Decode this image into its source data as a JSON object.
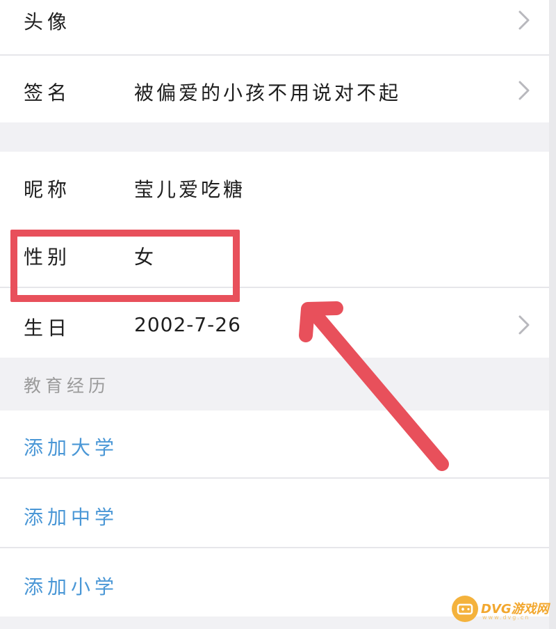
{
  "profile": {
    "avatar_label": "头像",
    "signature_label": "签名",
    "signature_value": "被偏爱的小孩不用说对不起",
    "nickname_label": "昵称",
    "nickname_value": "莹儿爱吃糖",
    "gender_label": "性别",
    "gender_value": "女",
    "birthday_label": "生日",
    "birthday_value": "2002-7-26"
  },
  "education": {
    "title": "教育经历",
    "add_university": "添加大学",
    "add_middle_school": "添加中学",
    "add_primary_school": "添加小学"
  },
  "watermark": {
    "text": "DVG游戏网",
    "sub": "www.dvg.cn"
  },
  "colors": {
    "accent_link": "#4a97d6",
    "annotation_red": "#e8505b",
    "watermark_orange": "#f4b23c"
  }
}
